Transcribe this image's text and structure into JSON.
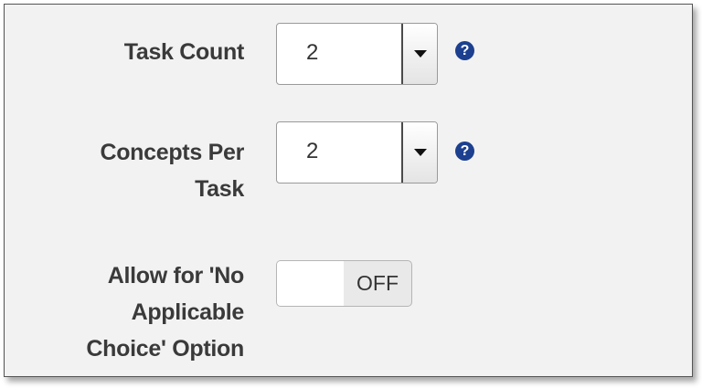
{
  "task_count": {
    "label": "Task Count",
    "value": "2",
    "help_icon": "?"
  },
  "concepts_per_task": {
    "label_line1": "Concepts Per",
    "label_line2": "Task",
    "value": "2",
    "help_icon": "?"
  },
  "no_applicable_choice": {
    "label_line1": "Allow for 'No",
    "label_line2": "Applicable",
    "label_line3": "Choice' Option",
    "state": "OFF"
  },
  "colors": {
    "panel_background": "#f2f2f2",
    "help_icon": "#1c3f8f",
    "label_text": "#3a3a3a"
  }
}
